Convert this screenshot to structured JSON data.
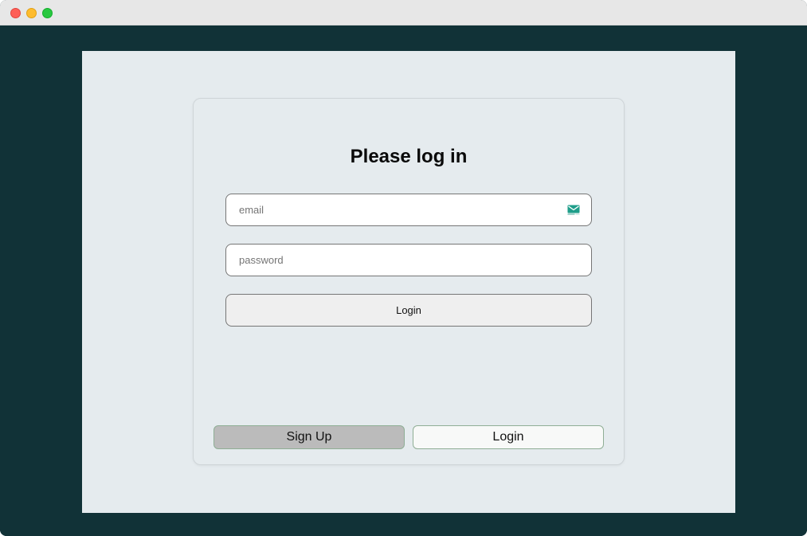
{
  "window": {
    "controls": [
      "close",
      "minimize",
      "maximize"
    ]
  },
  "login_card": {
    "title": "Please log in",
    "email": {
      "placeholder": "email",
      "value": "",
      "icon": "mail-icon"
    },
    "password": {
      "placeholder": "password",
      "value": ""
    },
    "submit_label": "Login"
  },
  "tabs": {
    "signup_label": "Sign Up",
    "login_label": "Login"
  },
  "colors": {
    "background": "#113237",
    "panel": "#e5ebee",
    "icon_accent": "#1f9e8a"
  }
}
